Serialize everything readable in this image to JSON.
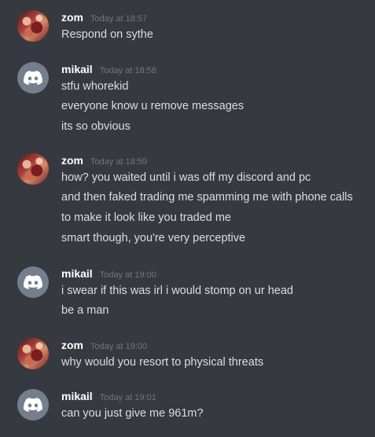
{
  "messages": [
    {
      "author": "zom",
      "timestamp": "Today at 18:57",
      "avatar": "user-avatar-image",
      "lines": [
        "Respond on sythe"
      ]
    },
    {
      "author": "mikail",
      "timestamp": "Today at 18:58",
      "avatar": "discord-default-avatar-icon",
      "lines": [
        "stfu whorekid",
        "everyone know u remove messages",
        "its so obvious"
      ]
    },
    {
      "author": "zom",
      "timestamp": "Today at 18:59",
      "avatar": "user-avatar-image",
      "lines": [
        "how? you waited until i was off my discord and pc",
        "and then faked trading me spamming me with phone calls",
        "to make it look like you traded me",
        "smart though, you're very perceptive"
      ]
    },
    {
      "author": "mikail",
      "timestamp": "Today at 19:00",
      "avatar": "discord-default-avatar-icon",
      "lines": [
        "i swear if this was irl i would stomp on ur head",
        "be a man"
      ]
    },
    {
      "author": "zom",
      "timestamp": "Today at 19:00",
      "avatar": "user-avatar-image",
      "lines": [
        "why would you resort to physical threats"
      ]
    },
    {
      "author": "mikail",
      "timestamp": "Today at 19:01",
      "avatar": "discord-default-avatar-icon",
      "lines": [
        "can you just give me 961m?"
      ]
    }
  ],
  "colors": {
    "background": "#36393f",
    "username": "#ffffff",
    "timestamp": "#72767d",
    "message_text": "#dcddde",
    "default_avatar": "#747f8d"
  }
}
